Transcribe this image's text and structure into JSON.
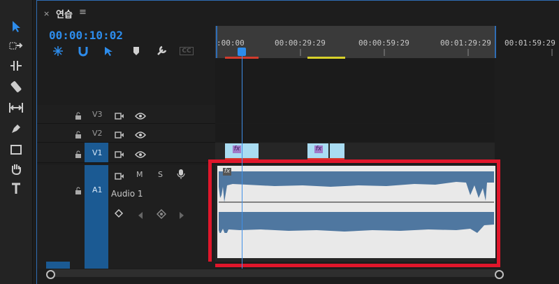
{
  "tab": {
    "close": "×",
    "title": "연습",
    "menu": "≡"
  },
  "timecode": "00:00:10:02",
  "header_icons": [
    "snap-icon",
    "magnet-icon",
    "linked-selection-icon",
    "marker-icon",
    "wrench-icon",
    "cc-icon"
  ],
  "cc_label": "CC",
  "tools": [
    "selection-tool-icon",
    "track-select-icon",
    "ripple-edit-icon",
    "razor-icon",
    "slip-icon",
    "pen-icon",
    "rectangle-icon",
    "hand-icon",
    "type-icon"
  ],
  "ruler": {
    "labels": [
      ":00:00",
      "00:00:29:29",
      "00:00:59:29",
      "00:01:29:29",
      "00:01:59:29"
    ]
  },
  "tracks": {
    "v3": "V3",
    "v2": "V2",
    "v1": "V1",
    "a1": "A1",
    "audio_name": "Audio 1",
    "mute": "M",
    "solo": "S"
  },
  "fx_label": "fx",
  "colors": {
    "accent": "#2d8ceb",
    "highlight_box": "#e0162b",
    "video_clip": "#a9dcf2",
    "waveform": "#4f77a0",
    "track_selected": "#1b5a93"
  }
}
